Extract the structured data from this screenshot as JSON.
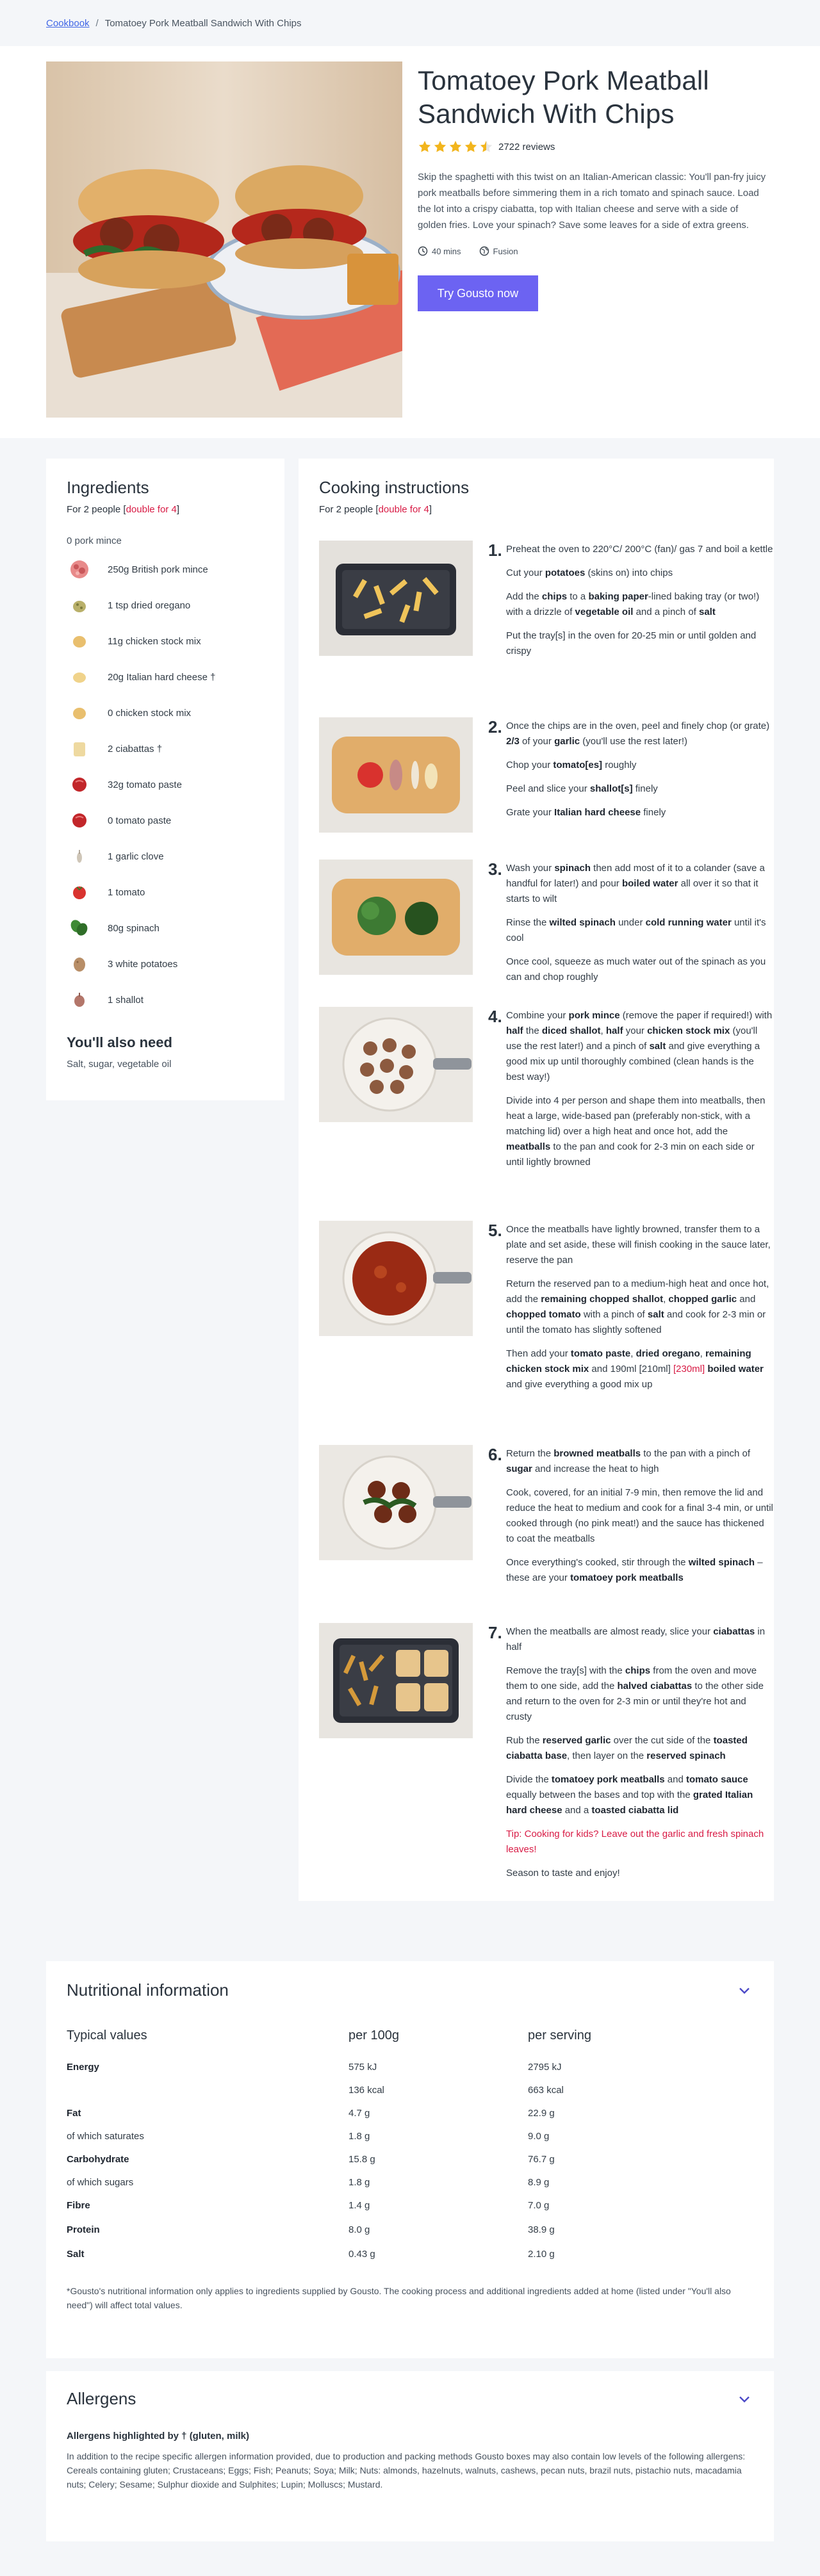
{
  "breadcrumb": {
    "link": "Cookbook",
    "separator": "/",
    "current": "Tomatoey Pork Meatball Sandwich With Chips"
  },
  "recipe": {
    "title": "Tomatoey Pork Meatball Sandwich With Chips",
    "rating": 4.5,
    "reviews": "2722 reviews",
    "description": "Skip the spaghetti with this twist on an Italian-American classic: You'll pan-fry juicy pork meatballs before simmering them in a rich tomato and spinach sauce. Load the lot into a crispy ciabatta, top with Italian cheese and serve with a side of golden fries. Love your spinach? Save some leaves for a side of extra greens.",
    "time": "40 mins",
    "cuisine": "Fusion",
    "cta": "Try Gousto now"
  },
  "ingredients": {
    "title": "Ingredients",
    "serves": "For 2 people",
    "double_label": "double for 4",
    "subheading": "0 pork mince",
    "items": [
      {
        "label": "250g British pork mince",
        "icon": "pork-mince-icon"
      },
      {
        "label": "1 tsp dried oregano",
        "icon": "oregano-icon"
      },
      {
        "label": "11g chicken stock mix",
        "icon": "stock-mix-icon"
      },
      {
        "label": "20g Italian hard cheese †",
        "icon": "cheese-icon"
      },
      {
        "label": "0 chicken stock mix",
        "icon": "stock-mix-icon"
      },
      {
        "label": "2 ciabattas †",
        "icon": "ciabatta-icon"
      },
      {
        "label": "32g tomato paste",
        "icon": "tomato-paste-icon"
      },
      {
        "label": "0 tomato paste",
        "icon": "tomato-paste-icon"
      },
      {
        "label": "1 garlic clove",
        "icon": "garlic-icon"
      },
      {
        "label": "1 tomato",
        "icon": "tomato-icon"
      },
      {
        "label": "80g spinach",
        "icon": "spinach-icon"
      },
      {
        "label": "3 white potatoes",
        "icon": "potato-icon"
      },
      {
        "label": "1 shallot",
        "icon": "shallot-icon"
      }
    ],
    "also_need_title": "You'll also need",
    "also_need_text": "Salt, sugar, vegetable oil"
  },
  "cooking": {
    "title": "Cooking instructions",
    "serves": "For 2 people",
    "double_label": "double for 4",
    "steps": [
      {
        "num": "1.",
        "paragraphs": [
          "Preheat the oven to 220°C/ 200°C (fan)/ gas 7 and boil a kettle",
          "Cut your **potatoes** (skins on) into chips",
          "Add the **chips** to a **baking paper**-lined baking tray (or two!) with a drizzle of **vegetable oil** and a pinch of **salt**",
          "Put the tray[s] in the oven for 20-25 min or until golden and crispy"
        ]
      },
      {
        "num": "2.",
        "paragraphs": [
          "Once the chips are in the oven, peel and finely chop (or grate) **2/3** of your **garlic** (you'll use the rest later!)",
          "Chop your **tomato[es]** roughly",
          "Peel and slice your **shallot[s]** finely",
          "Grate your **Italian hard cheese** finely"
        ]
      },
      {
        "num": "3.",
        "paragraphs": [
          "Wash your **spinach** then add most of it to a colander (save a handful for later!) and pour **boiled water** all over it so that it starts to wilt",
          "Rinse the **wilted spinach** under **cold running water** until it's cool",
          "Once cool, squeeze as much water out of the spinach as you can and chop roughly"
        ]
      },
      {
        "num": "4.",
        "paragraphs": [
          "Combine your **pork mince** (remove the paper if required!) with **half** the **diced shallot**, **half** your **chicken stock mix** (you'll use the rest later!) and a pinch of **salt** and give everything a good mix up until thoroughly combined (clean hands is the best way!)",
          "Divide into 4 per person and shape them into meatballs, then heat a large, wide-based pan (preferably non-stick, with a matching lid) over a high heat and once hot, add the **meatballs** to the pan and cook for 2-3 min on each side or until lightly browned"
        ]
      },
      {
        "num": "5.",
        "paragraphs": [
          "Once the meatballs have lightly browned, transfer them to a plate and set aside, these will finish cooking in the sauce later, reserve the pan",
          "Return the reserved pan to a medium-high heat and once hot, add the **remaining chopped shallot**, **chopped garlic** and **chopped tomato** with a pinch of **salt** and cook for 2-3 min or until the tomato has slightly softened",
          "Then add your **tomato paste**, **dried oregano**, **remaining chicken stock mix** and 190ml [210ml] ^^[230ml]^^ **boiled water** and give everything a good mix up"
        ]
      },
      {
        "num": "6.",
        "paragraphs": [
          "Return the **browned meatballs** to the pan with a pinch of **sugar** and increase the heat to high",
          "Cook, covered, for an initial 7-9 min, then remove the lid and reduce the heat to medium and cook for a final 3-4 min, or until cooked through (no pink meat!) and the sauce has thickened to coat the meatballs",
          "Once everything's cooked, stir through the **wilted spinach** – these are your **tomatoey pork meatballs**"
        ]
      },
      {
        "num": "7.",
        "paragraphs": [
          "When the meatballs are almost ready, slice your **ciabattas** in half",
          "Remove the tray[s] with the **chips** from the oven and move them to one side, add the **halved ciabattas** to the other side and return to the oven for 2-3 min or until they're hot and crusty",
          "Rub the **reserved garlic** over the cut side of the **toasted ciabatta base**, then layer on the **reserved spinach**",
          "Divide the **tomatoey pork meatballs** and **tomato sauce** equally between the bases and top with the **grated Italian hard cheese** and a **toasted ciabatta lid**",
          "!!Tip: Cooking for kids? Leave out the garlic and fresh spinach leaves!",
          "Season to taste and enjoy!"
        ]
      }
    ]
  },
  "nutrition": {
    "title": "Nutritional information",
    "headers": [
      "Typical values",
      "per 100g",
      "per serving"
    ],
    "rows": [
      {
        "label": "Energy",
        "bold": true,
        "per100": "575 kJ",
        "serving": "2795 kJ"
      },
      {
        "label": "",
        "bold": false,
        "per100": "136 kcal",
        "serving": "663 kcal"
      },
      {
        "label": "Fat",
        "bold": true,
        "per100": "4.7 g",
        "serving": "22.9 g"
      },
      {
        "label": "of which saturates",
        "bold": false,
        "per100": "1.8 g",
        "serving": "9.0 g"
      },
      {
        "label": "Carbohydrate",
        "bold": true,
        "per100": "15.8 g",
        "serving": "76.7 g"
      },
      {
        "label": "of which sugars",
        "bold": false,
        "per100": "1.8 g",
        "serving": "8.9 g"
      },
      {
        "label": "Fibre",
        "bold": true,
        "per100": "1.4 g",
        "serving": "7.0 g"
      },
      {
        "label": "Protein",
        "bold": true,
        "per100": "8.0 g",
        "serving": "38.9 g"
      },
      {
        "label": "Salt",
        "bold": true,
        "per100": "0.43 g",
        "serving": "2.10 g"
      }
    ],
    "footnote": "*Gousto's nutritional information only applies to ingredients supplied by Gousto. The cooking process and additional ingredients added at home (listed under \"You'll also need\") will affect total values."
  },
  "allergens": {
    "title": "Allergens",
    "highlighted": "Allergens highlighted by † (gluten, milk)",
    "text": "In addition to the recipe specific allergen information provided, due to production and packing methods Gousto boxes may also contain low levels of the following allergens: Cereals containing gluten; Crustaceans; Eggs; Fish; Peanuts; Soya; Milk; Nuts: almonds, hazelnuts, walnuts, cashews, pecan nuts, brazil nuts, pistachio nuts, macadamia nuts; Celery; Sesame; Sulphur dioxide and Sulphites; Lupin; Molluscs; Mustard."
  },
  "colors": {
    "accent": "#6c63f2",
    "link": "#4066e6",
    "highlight": "#d81b45",
    "star": "#f2b51d"
  }
}
